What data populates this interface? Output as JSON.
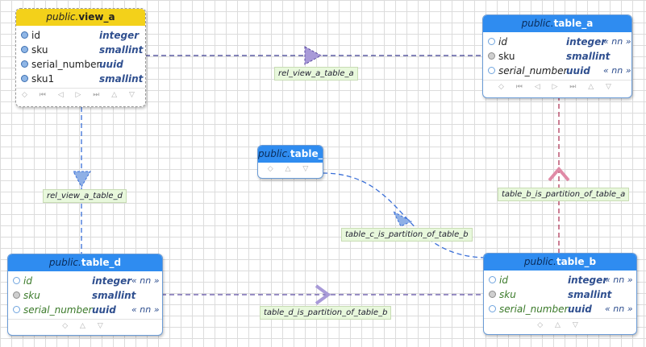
{
  "tables": {
    "view_a": {
      "schema": "public.",
      "name": "view_a",
      "columns": [
        {
          "name": "id",
          "type": "integer",
          "constraint": ""
        },
        {
          "name": "sku",
          "type": "smallint",
          "constraint": ""
        },
        {
          "name": "serial_number",
          "type": "uuid",
          "constraint": ""
        },
        {
          "name": "sku1",
          "type": "smallint",
          "constraint": ""
        }
      ],
      "footer": "◇ ⏮ ◁ ▷ ⏭ △ ▽"
    },
    "table_a": {
      "schema": "public.",
      "name": "table_a",
      "columns": [
        {
          "name": "id",
          "type": "integer",
          "constraint": "« nn »"
        },
        {
          "name": "sku",
          "type": "smallint",
          "constraint": ""
        },
        {
          "name": "serial_number",
          "type": "uuid",
          "constraint": "« nn »"
        }
      ],
      "footer": "◇ ⏮ ◁ ▷ ⏭ △ ▽"
    },
    "table_c": {
      "schema": "public.",
      "name": "table_c",
      "footer": "◇ △ ▽"
    },
    "table_d": {
      "schema": "public.",
      "name": "table_d",
      "columns": [
        {
          "name": "id",
          "type": "integer",
          "constraint": "« nn »"
        },
        {
          "name": "sku",
          "type": "smallint",
          "constraint": ""
        },
        {
          "name": "serial_number",
          "type": "uuid",
          "constraint": "« nn »"
        }
      ],
      "footer": "◇ △ ▽"
    },
    "table_b": {
      "schema": "public.",
      "name": "table_b",
      "columns": [
        {
          "name": "id",
          "type": "integer",
          "constraint": "« nn »"
        },
        {
          "name": "sku",
          "type": "smallint",
          "constraint": ""
        },
        {
          "name": "serial_number",
          "type": "uuid",
          "constraint": "« nn »"
        }
      ],
      "footer": "◇ △ ▽"
    }
  },
  "relations": {
    "rel_view_a_table_a": "rel_view_a_table_a",
    "rel_view_a_table_d": "rel_view_a_table_d",
    "table_b_is_partition_of_table_a": "table_b_is_partition_of_table_a",
    "table_c_is_partition_of_table_b": "table_c_is_partition_of_table_b",
    "table_d_is_partition_of_table_b": "table_d_is_partition_of_table_b"
  },
  "colors": {
    "view_header": "#f3d11a",
    "table_header": "#2f8cf0",
    "edge_view": "#3b3b8f",
    "edge_partition_blue": "#3a6fd8",
    "edge_partition_red": "#b03a5a",
    "edge_partition_purple": "#5a4aa0",
    "label_bg": "#e8f8dc"
  }
}
